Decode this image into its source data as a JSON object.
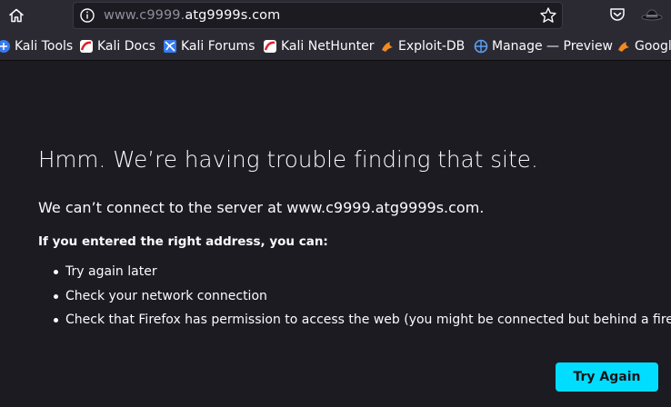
{
  "toolbar": {
    "url_prefix": "www.c9999.",
    "url_host": "atg9999s.com",
    "icons": [
      "home-icon",
      "info-icon",
      "star-icon",
      "pocket-icon",
      "extension-icon"
    ]
  },
  "bookmarks": [
    {
      "label": "Kali Tools",
      "icon": "kali-tools-icon"
    },
    {
      "label": "Kali Docs",
      "icon": "kali-docs-icon"
    },
    {
      "label": "Kali Forums",
      "icon": "kali-forums-icon"
    },
    {
      "label": "Kali NetHunter",
      "icon": "kali-nethunter-icon"
    },
    {
      "label": "Exploit-DB",
      "icon": "exploit-db-icon"
    },
    {
      "label": "Manage — Preview",
      "icon": "manage-icon"
    },
    {
      "label": "Google",
      "icon": "google-hacking-icon"
    }
  ],
  "error": {
    "title": "Hmm. We’re having trouble finding that site.",
    "description": "We can’t connect to the server at www.c9999.atg9999s.com.",
    "hint": "If you entered the right address, you can:",
    "suggestions": [
      "Try again later",
      "Check your network connection",
      "Check that Firefox has permission to access the web (you might be connected but behind a firewall)"
    ],
    "button_label": "Try Again"
  },
  "colors": {
    "background": "#1c1b22",
    "toolbar": "#2b2a33",
    "accent_button": "#00ddff",
    "text": "#fbfbfe",
    "dim_text": "#8f8f9d"
  }
}
